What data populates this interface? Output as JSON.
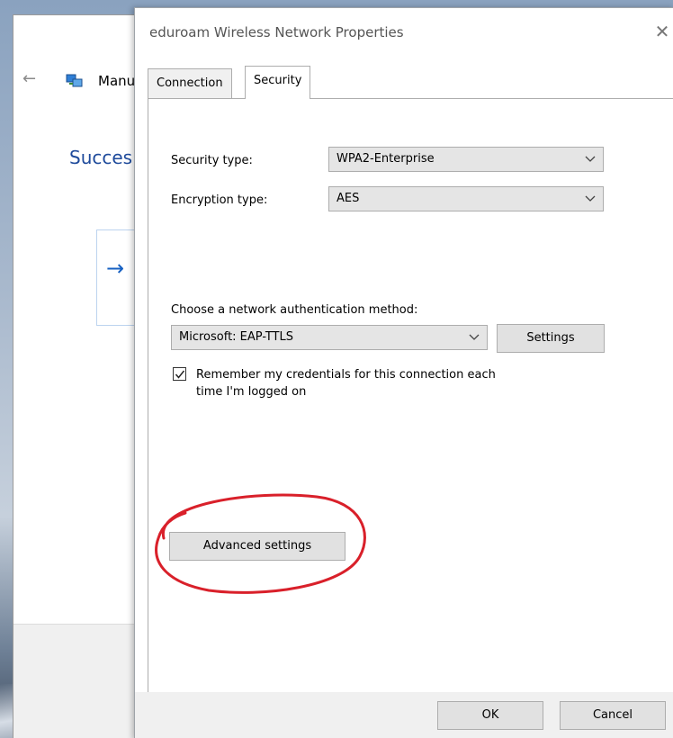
{
  "background_window": {
    "title": "Manu",
    "heading": "Succes",
    "back_icon": "back-arrow-icon",
    "network_icon": "network-icon",
    "option_icon": "right-arrow-icon"
  },
  "dialog": {
    "title": "eduroam Wireless Network Properties",
    "close_icon": "close-icon",
    "tabs": [
      {
        "label": "Connection",
        "active": false
      },
      {
        "label": "Security",
        "active": true
      }
    ],
    "security_type": {
      "label": "Security type:",
      "value": "WPA2-Enterprise"
    },
    "encryption_type": {
      "label": "Encryption type:",
      "value": "AES"
    },
    "auth_method": {
      "label": "Choose a network authentication method:",
      "value": "Microsoft: EAP-TTLS",
      "settings_label": "Settings"
    },
    "remember_credentials": {
      "checked": true,
      "label_line1": "Remember my credentials for this connection each",
      "label_line2": "time I'm logged on"
    },
    "advanced_settings_label": "Advanced settings",
    "ok_label": "OK",
    "cancel_label": "Cancel"
  },
  "colors": {
    "highlight_ellipse": "#d9202a",
    "heading_blue": "#1e4a9b",
    "arrow_blue": "#1660c2"
  }
}
